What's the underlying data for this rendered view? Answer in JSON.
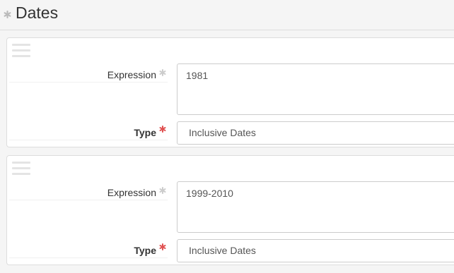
{
  "header": {
    "title": "Dates",
    "icon": "asterisk-icon"
  },
  "dates": [
    {
      "expression_label": "Expression",
      "expression_value": "1981",
      "type_label": "Type",
      "type_value": "Inclusive Dates"
    },
    {
      "expression_label": "Expression",
      "expression_value": "1999-2010",
      "type_label": "Type",
      "type_value": "Inclusive Dates"
    }
  ],
  "colors": {
    "required_red": "#e05252",
    "optional_grey": "#cccccc",
    "border": "#dddddd"
  }
}
